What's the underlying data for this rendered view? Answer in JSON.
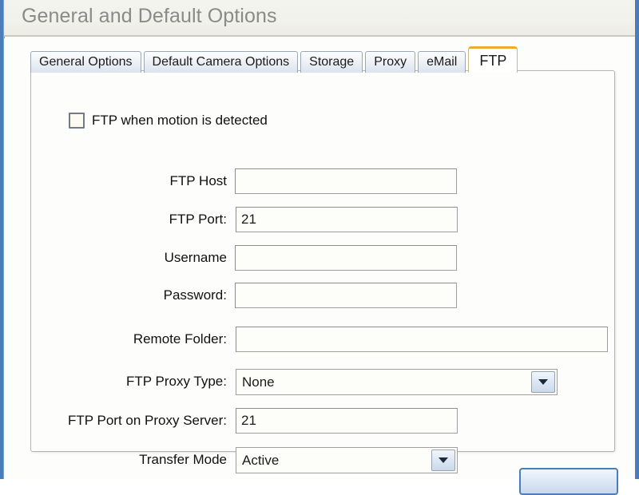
{
  "window": {
    "title": "General and Default Options",
    "border_color": "#4a7ebb"
  },
  "tabs": {
    "items": [
      {
        "label": "General Options",
        "active": false
      },
      {
        "label": "Default Camera Options",
        "active": false
      },
      {
        "label": "Storage",
        "active": false
      },
      {
        "label": "Proxy",
        "active": false
      },
      {
        "label": "eMail",
        "active": false
      },
      {
        "label": "FTP",
        "active": true
      }
    ],
    "active_tab": "FTP",
    "active_accent_color": "#f0a92e"
  },
  "form": {
    "motion_checkbox": {
      "label": "FTP when motion is detected",
      "checked": false
    },
    "fields": [
      {
        "label": "FTP Host",
        "value": "",
        "placeholder": "",
        "type": "text"
      },
      {
        "label": "FTP Port:",
        "value": "21",
        "placeholder": "",
        "type": "text"
      },
      {
        "label": "Username",
        "value": "",
        "placeholder": "",
        "type": "text"
      },
      {
        "label": "Password:",
        "value": "",
        "placeholder": "",
        "type": "password"
      },
      {
        "label": "Remote Folder:",
        "value": "",
        "placeholder": "",
        "type": "text"
      },
      {
        "label": "FTP Proxy Type:",
        "value": "None",
        "type": "select"
      },
      {
        "label": "FTP Port on Proxy Server:",
        "value": "21",
        "type": "text"
      },
      {
        "label": "Transfer Mode",
        "value": "Active",
        "type": "select"
      }
    ]
  },
  "footer": {
    "ok_button_label": ""
  }
}
